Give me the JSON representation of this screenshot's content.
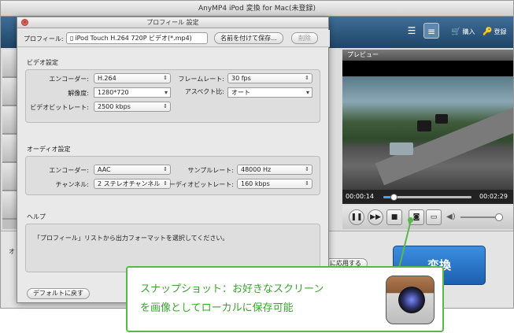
{
  "window": {
    "title": "AnyMP4 iPod 変換 for Mac(未登録)"
  },
  "toolbar": {
    "buy_label": "購入",
    "register_label": "登録"
  },
  "preview": {
    "title": "プレビュー",
    "time_current": "00:00:14",
    "time_total": "00:02:29",
    "progress": 0.12,
    "volume": 0.9
  },
  "bottom": {
    "apply_label": "に応用する",
    "convert_label": "変換",
    "left_text": "オ"
  },
  "dialog": {
    "title": "プロフィール 設定",
    "profile_label": "プロフィール:",
    "profile_value": "iPod Touch H.264 720P ビデオ(*.mp4)",
    "save_as_label": "名前を付けて保存...",
    "delete_label": "削除",
    "video": {
      "section": "ビデオ設定",
      "encoder_label": "エンコーダー:",
      "encoder_value": "H.264",
      "framerate_label": "フレームレート:",
      "framerate_value": "30 fps",
      "resolution_label": "解像度:",
      "resolution_value": "1280*720",
      "aspect_label": "アスペクト比:",
      "aspect_value": "オート",
      "bitrate_label": "ビデオビットレート:",
      "bitrate_value": "2500 kbps"
    },
    "audio": {
      "section": "オーディオ設定",
      "encoder_label": "エンコーダー:",
      "encoder_value": "AAC",
      "samplerate_label": "サンプルレート:",
      "samplerate_value": "48000 Hz",
      "channel_label": "チャンネル:",
      "channel_value": "2 ステレオチャンネル",
      "bitrate_label": "ーディオビットレート:",
      "bitrate_value": "160 kbps"
    },
    "help": {
      "section": "ヘルプ",
      "text": "「プロフィール」リストから出力フォーマットを選択してください。"
    },
    "default_label": "デフォルトに戻す"
  },
  "callout": {
    "line1": "スナップショット：お好きなスクリーン",
    "line2": "を画像としてローカルに保存可能"
  }
}
